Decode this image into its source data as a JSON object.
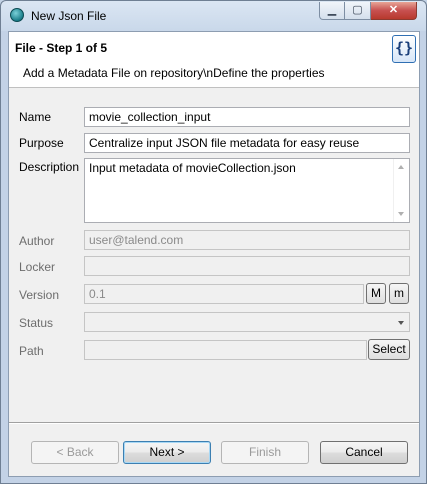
{
  "window": {
    "title": "New Json File",
    "icon": "talend-icon",
    "controls": {
      "minimize": "▁",
      "maximize": "▢",
      "close": "✕"
    }
  },
  "header": {
    "title": "File - Step 1 of 5",
    "description": "Add a Metadata File on repository\\nDefine the properties",
    "icon": "json-file-icon",
    "icon_glyph": "{}"
  },
  "form": {
    "name": {
      "label": "Name",
      "value": "movie_collection_input"
    },
    "purpose": {
      "label": "Purpose",
      "value": "Centralize input JSON file metadata for easy reuse"
    },
    "description": {
      "label": "Description",
      "value": "Input metadata of movieCollection.json"
    },
    "author": {
      "label": "Author",
      "value": "user@talend.com"
    },
    "locker": {
      "label": "Locker",
      "value": ""
    },
    "version": {
      "label": "Version",
      "value": "0.1",
      "major_button": "M",
      "minor_button": "m"
    },
    "status": {
      "label": "Status",
      "value": ""
    },
    "path": {
      "label": "Path",
      "value": "",
      "select_button": "Select"
    }
  },
  "buttons": {
    "back": "< Back",
    "next": "Next >",
    "finish": "Finish",
    "cancel": "Cancel"
  }
}
